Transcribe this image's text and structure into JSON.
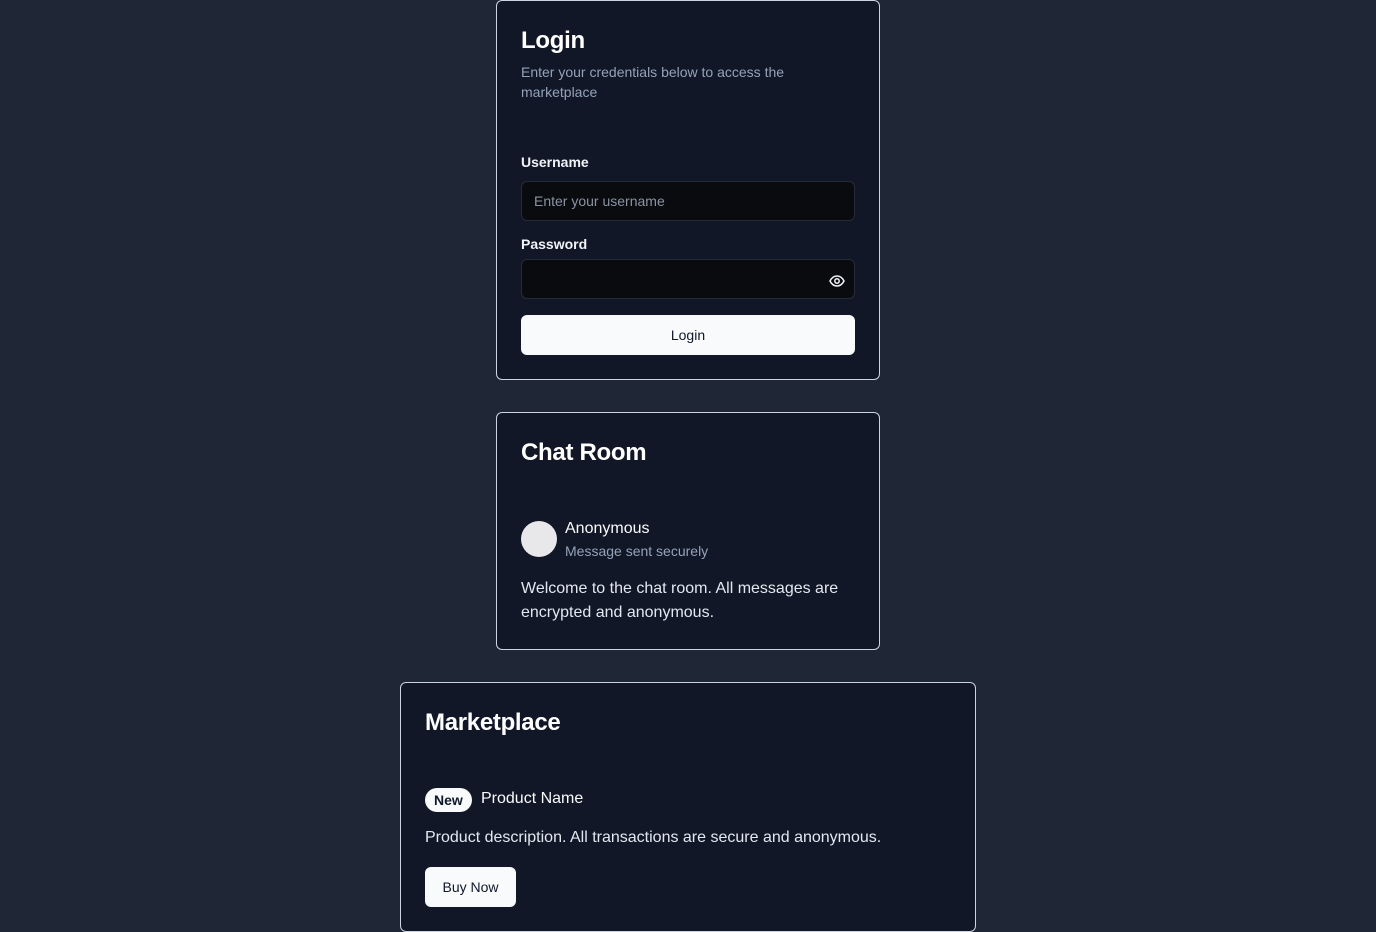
{
  "login": {
    "title": "Login",
    "description": "Enter your credentials below to access the marketplace",
    "username_label": "Username",
    "username_placeholder": "Enter your username",
    "username_value": "",
    "password_label": "Password",
    "password_value": "",
    "password_toggle_icon": "eye-icon",
    "submit_label": "Login"
  },
  "chat": {
    "title": "Chat Room",
    "avatar_icon": "avatar",
    "user": "Anonymous",
    "status": "Message sent securely",
    "message": "Welcome to the chat room. All messages are encrypted and anonymous."
  },
  "marketplace": {
    "title": "Marketplace",
    "badge": "New",
    "product_name": "Product Name",
    "product_description": "Product description. All transactions are secure and anonymous.",
    "buy_label": "Buy Now"
  },
  "colors": {
    "page_background": "#1f2636",
    "card_background": "#111726",
    "card_border": "#cbd5e1",
    "input_background": "#0a0b0f",
    "button_background": "#f8fafc",
    "muted_text": "#94a3b8"
  }
}
